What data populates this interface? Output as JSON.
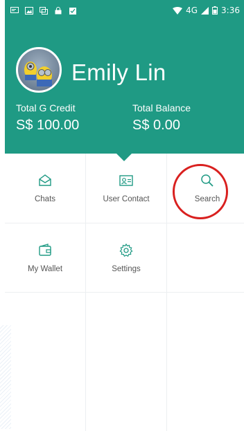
{
  "status_bar": {
    "left_icons": [
      "message-icon",
      "image-icon",
      "copy-icon",
      "lock-icon",
      "clipboard-check-icon"
    ],
    "network": "4G",
    "time": "3:36"
  },
  "profile": {
    "name": "Emily Lin",
    "credit_label": "Total G Credit",
    "credit_value": "S$ 100.00",
    "balance_label": "Total Balance",
    "balance_value": "S$ 0.00"
  },
  "menu": {
    "items": [
      {
        "label": "Chats",
        "icon": "mail-icon"
      },
      {
        "label": "User Contact",
        "icon": "contact-card-icon"
      },
      {
        "label": "Search",
        "icon": "search-icon"
      },
      {
        "label": "My Wallet",
        "icon": "wallet-icon"
      },
      {
        "label": "Settings",
        "icon": "gear-icon"
      }
    ]
  },
  "colors": {
    "primary": "#1f9a84",
    "icon": "#1f9a84",
    "highlight": "#d9201f"
  }
}
